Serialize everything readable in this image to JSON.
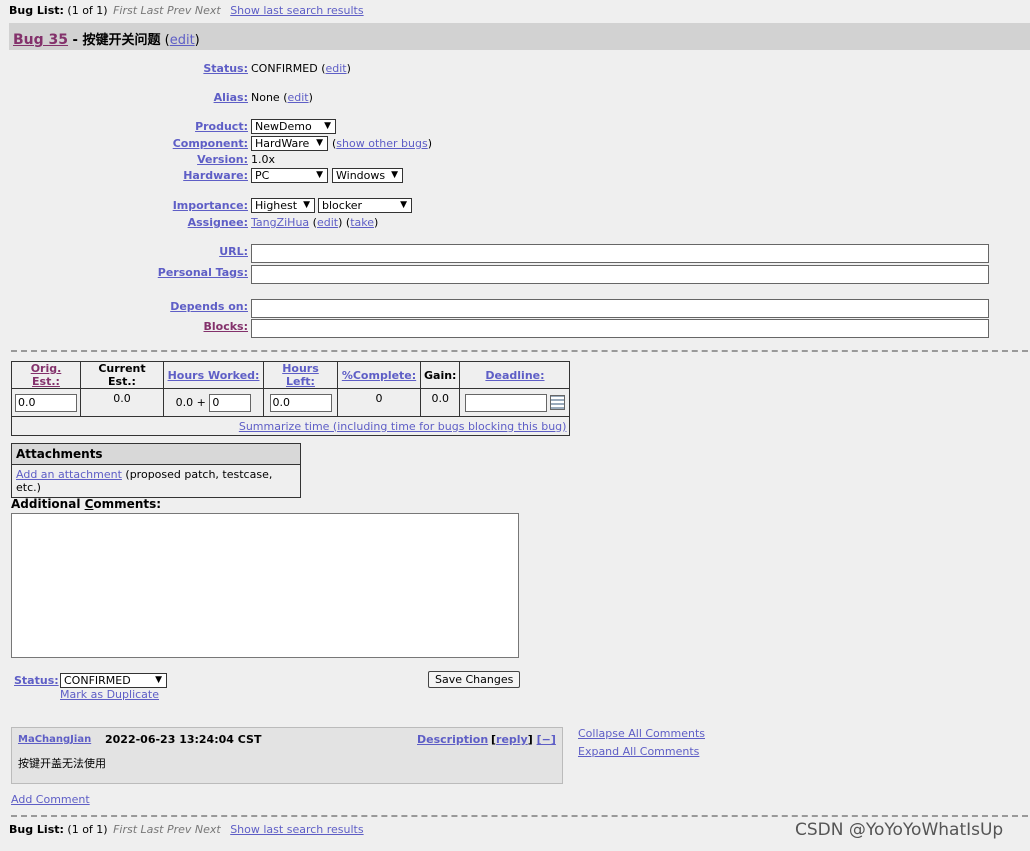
{
  "buglist": {
    "label": "Bug List:",
    "count": "(1 of 1)",
    "nav": "First Last Prev Next",
    "show": "Show last search results"
  },
  "bug": {
    "id_label": "Bug 35",
    "sep": " - ",
    "summary": "按键开关问题",
    "edit": "edit"
  },
  "fields": {
    "status": {
      "label": "Status:",
      "value": "CONFIRMED",
      "edit": "edit"
    },
    "alias": {
      "label": "Alias:",
      "value": "None",
      "edit": "edit"
    },
    "product": {
      "label": "Product:",
      "value": "NewDemo"
    },
    "component": {
      "label": "Component:",
      "value": "HardWare",
      "other": "show other bugs"
    },
    "version": {
      "label": "Version:",
      "value": "1.0x"
    },
    "hardware": {
      "label": "Hardware:",
      "platform": "PC",
      "os": "Windows"
    },
    "importance": {
      "label": "Importance:",
      "priority": "Highest",
      "severity": "blocker"
    },
    "assignee": {
      "label": "Assignee:",
      "value": "TangZiHua",
      "edit": "edit",
      "take": "take"
    },
    "url": {
      "label": "URL:",
      "value": ""
    },
    "tags": {
      "label": "Personal Tags:",
      "value": ""
    },
    "depends": {
      "label": "Depends on:",
      "value": ""
    },
    "blocks": {
      "label": "Blocks:",
      "value": ""
    }
  },
  "time": {
    "headers": [
      "Orig. Est.:",
      "Current Est.:",
      "Hours Worked:",
      "Hours Left:",
      "%Complete:",
      "Gain:",
      "Deadline:"
    ],
    "orig": "0.0",
    "current": "0.0",
    "worked": "0.0 +",
    "worked_input": "0",
    "left": "0.0",
    "complete": "0",
    "gain": "0.0",
    "deadline": "",
    "summarize": "Summarize time (including time for bugs blocking this bug)"
  },
  "attachments": {
    "title": "Attachments",
    "add": "Add an attachment",
    "hint": "(proposed patch, testcase, etc.)"
  },
  "comment_form": {
    "label_pre": "Additional ",
    "label_u": "C",
    "label_post": "omments:",
    "status_label": "Status:",
    "status_value": "CONFIRMED",
    "dup": "Mark as Duplicate",
    "save": "Save Changes"
  },
  "comment": {
    "author": "MaChangJian",
    "date": "2022-06-23 13:24:04 CST",
    "desc": "Description",
    "reply": "reply",
    "collapse_toggle": "[−]",
    "body": "按键开盖无法使用"
  },
  "side": {
    "collapse": "Collapse All Comments",
    "expand": "Expand All Comments"
  },
  "add_comment": "Add Comment",
  "watermark": "CSDN @YoYoYoWhatIsUp"
}
